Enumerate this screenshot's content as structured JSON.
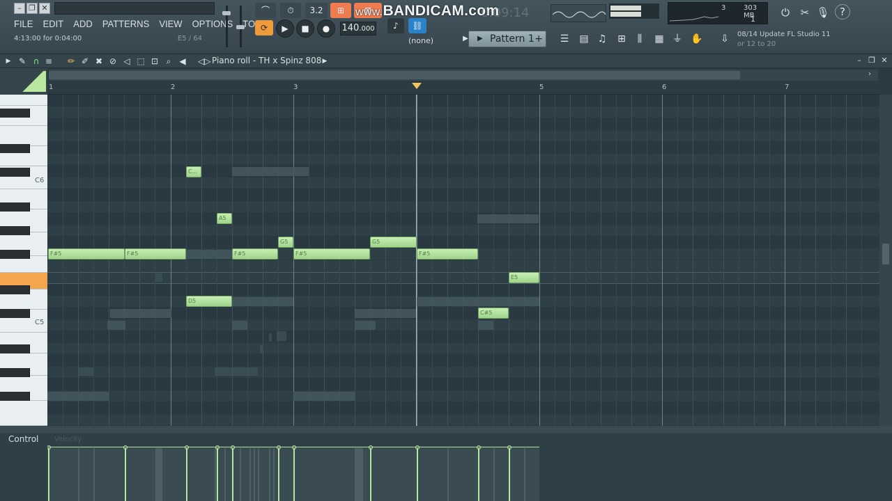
{
  "menu": [
    "FILE",
    "EDIT",
    "ADD",
    "PATTERNS",
    "VIEW",
    "OPTIONS",
    "TOOLS",
    "?"
  ],
  "hint": {
    "text": "4:13:00 for 0:04:00",
    "right": "E5 / 64"
  },
  "toolbar": {
    "snap_value": "3.2",
    "tempo": "140",
    "tempo_decimals": ".000",
    "pattern": "Pattern 1",
    "none_label": "(none)",
    "time_display": "0:09:14"
  },
  "watermark": {
    "prefix": "www.",
    "text": "BANDICAM.com"
  },
  "monitor": {
    "cpu_label": "3",
    "mem": "303 MB",
    "poly": "1"
  },
  "news": {
    "line1": "08/14  Update FL Studio 11",
    "line2": "or 12 to 20"
  },
  "piano_roll": {
    "title": "Piano roll - TH x Spinz 808"
  },
  "timeline": {
    "bars": [
      "1",
      "2",
      "3",
      "",
      "5",
      "6",
      "7"
    ]
  },
  "keyboard": {
    "c6_label": "C6",
    "c5_label": "C5"
  },
  "notes": [
    {
      "label": "C...",
      "pitch": "C6"
    },
    {
      "label": "A5",
      "pitch": "A5"
    },
    {
      "label": "G5",
      "pitch": "G5"
    },
    {
      "label": "G5",
      "pitch": "G5"
    },
    {
      "label": "F#5",
      "pitch": "F#5"
    },
    {
      "label": "F#5",
      "pitch": "F#5"
    },
    {
      "label": "F#5",
      "pitch": "F#5"
    },
    {
      "label": "F#5",
      "pitch": "F#5"
    },
    {
      "label": "F#5",
      "pitch": "F#5"
    },
    {
      "label": "E5",
      "pitch": "E5"
    },
    {
      "label": "D5",
      "pitch": "D5"
    },
    {
      "label": "C#5",
      "pitch": "C#5"
    }
  ],
  "control": {
    "label": "Control",
    "target": "Velocity"
  },
  "colors": {
    "note": "#b2e39c",
    "background": "#2f3f46",
    "accent": "#f3a64b",
    "playhead": "#f3c55c"
  }
}
